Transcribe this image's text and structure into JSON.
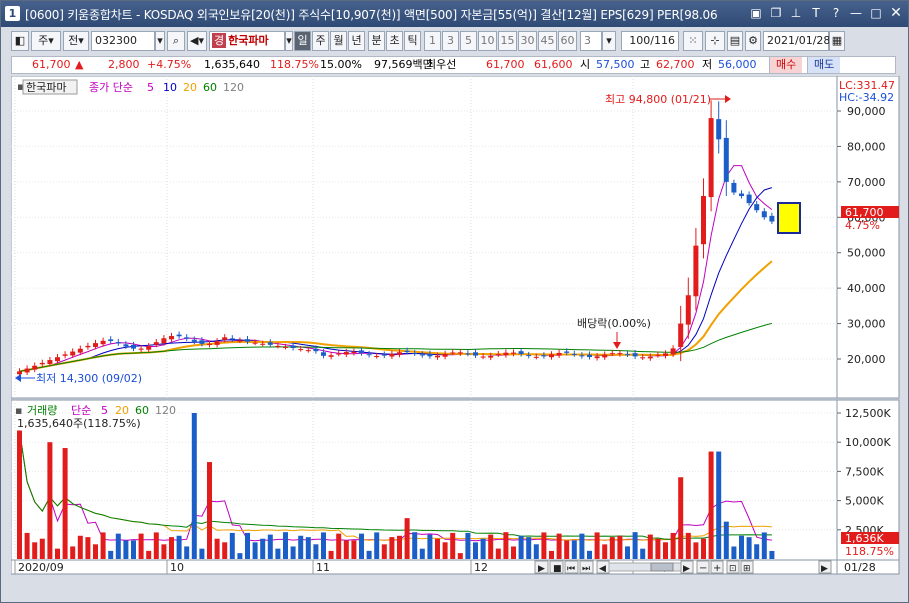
{
  "window": {
    "number": "1",
    "title": "[0600] 키움종합차트 - KOSDAQ 외국인보유[20(천)] 주식수[10,907(천)] 액면[500] 자본금[55(억)] 결산[12월] EPS[629] PER[98.06"
  },
  "toolbar": {
    "type_label": "주",
    "prev_label": "전",
    "code": "032300",
    "stock_badge": "경",
    "stock_name": "한국파마",
    "periods": [
      "일",
      "주",
      "월",
      "년",
      "분",
      "초",
      "틱"
    ],
    "minutes": [
      "1",
      "3",
      "5",
      "10",
      "15",
      "30",
      "45",
      "60"
    ],
    "interval": "3",
    "count": "100/116",
    "date": "2021/01/28"
  },
  "quote": {
    "price": "61,700",
    "arrow": "▲",
    "change": "2,800",
    "change_pct": "+4.75%",
    "volume": "1,635,640",
    "vol_ratio": "118.75%",
    "turnover": "15.00%",
    "amount": "97,569백만",
    "best_bid_label": "최우선",
    "ask": "61,700",
    "bid": "61,600",
    "open_label": "시",
    "open": "57,500",
    "high_label": "고",
    "high": "62,700",
    "low_label": "저",
    "low": "56,000",
    "buy_label": "매수",
    "sell_label": "매도"
  },
  "price_panel": {
    "name": "한국파마",
    "ma_label": "종가 단순",
    "ma_periods": [
      "5",
      "10",
      "20",
      "60",
      "120"
    ],
    "lc": "LC:331.47",
    "hc": "HC:-34.92",
    "y_ticks": [
      "90,000",
      "80,000",
      "70,000",
      "60,000",
      "50,000",
      "40,000",
      "30,000",
      "20,000"
    ],
    "last_price": "61,700",
    "last_pct": "4.75%",
    "high_annotation": "최고 94,800 (01/21)",
    "low_annotation": "최저 14,300 (09/02)",
    "dividend_annotation": "배당락(0.00%)"
  },
  "volume_panel": {
    "label": "거래량",
    "ma_label": "단순",
    "ma_periods": [
      "5",
      "20",
      "60",
      "120"
    ],
    "value": "1,635,640주(118.75%)",
    "y_ticks": [
      "12,500K",
      "10,000K",
      "7,500K",
      "5,000K",
      "2,500K"
    ],
    "last_vol": "1,636K",
    "last_pct": "118.75%"
  },
  "x_axis": {
    "labels": [
      "2020/09",
      "10",
      "11",
      "12",
      "2021/01"
    ],
    "right_label": "01/28"
  },
  "colors": {
    "up": "#e21b1b",
    "down": "#1b5ec8",
    "ma5": "#c000c0",
    "ma10": "#0000c0",
    "ma20": "#f0a000",
    "ma60": "#008000",
    "ma120": "#808080"
  }
}
